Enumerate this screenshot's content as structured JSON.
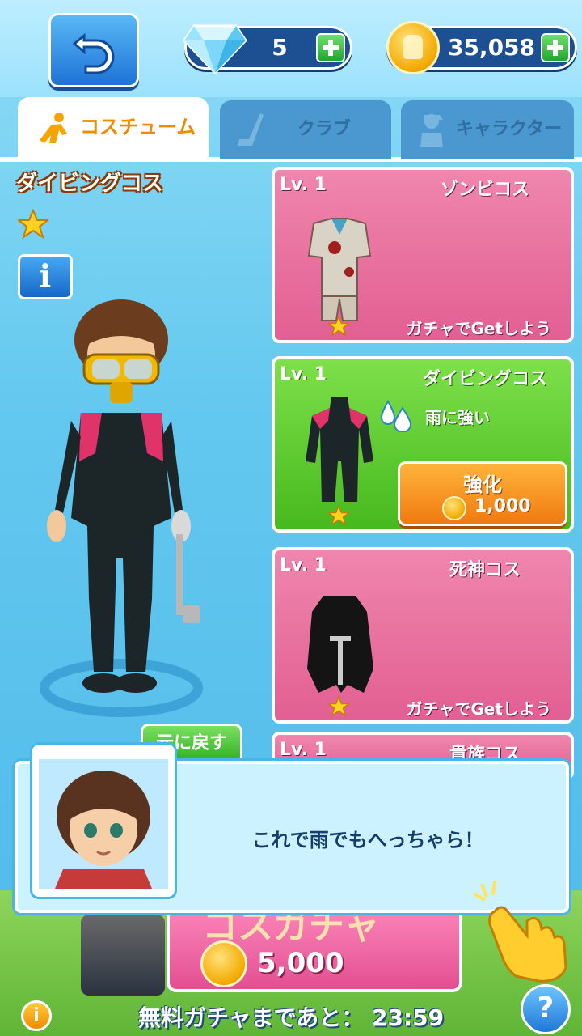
{
  "header": {
    "gems": "5",
    "coins": "35,058"
  },
  "tabs": [
    {
      "label": "コスチューム",
      "active": true
    },
    {
      "label": "クラブ",
      "active": false
    },
    {
      "label": "キャラクター",
      "active": false
    }
  ],
  "selected": {
    "name": "ダイビングコス",
    "stars": 1,
    "info_label": "i",
    "back_label": "元に戻す"
  },
  "costumes": [
    {
      "level": "Lv. 1",
      "name": "ゾンビコス",
      "note": "ガチャでGetしよう"
    },
    {
      "level": "Lv. 1",
      "name": "ダイビングコス",
      "ability": "雨に強い",
      "upgrade_label": "強化",
      "upgrade_price": "1,000"
    },
    {
      "level": "Lv. 1",
      "name": "死神コス",
      "note": "ガチャでGetしよう"
    },
    {
      "level": "Lv. 1",
      "name": "貴族コス"
    }
  ],
  "gacha": {
    "title": "コスガチャ",
    "price": "5,000",
    "timer_text": "無料ガチャまであと： 23:59"
  },
  "dialog": {
    "text": "これで雨でもへっちゃら！"
  },
  "buttons": {
    "info_round": "i",
    "help": "?"
  },
  "colors": {
    "accent_orange": "#f28a00",
    "card_pink": "#e25f92",
    "card_green": "#46b91e",
    "header_blue": "#1d4f93"
  }
}
